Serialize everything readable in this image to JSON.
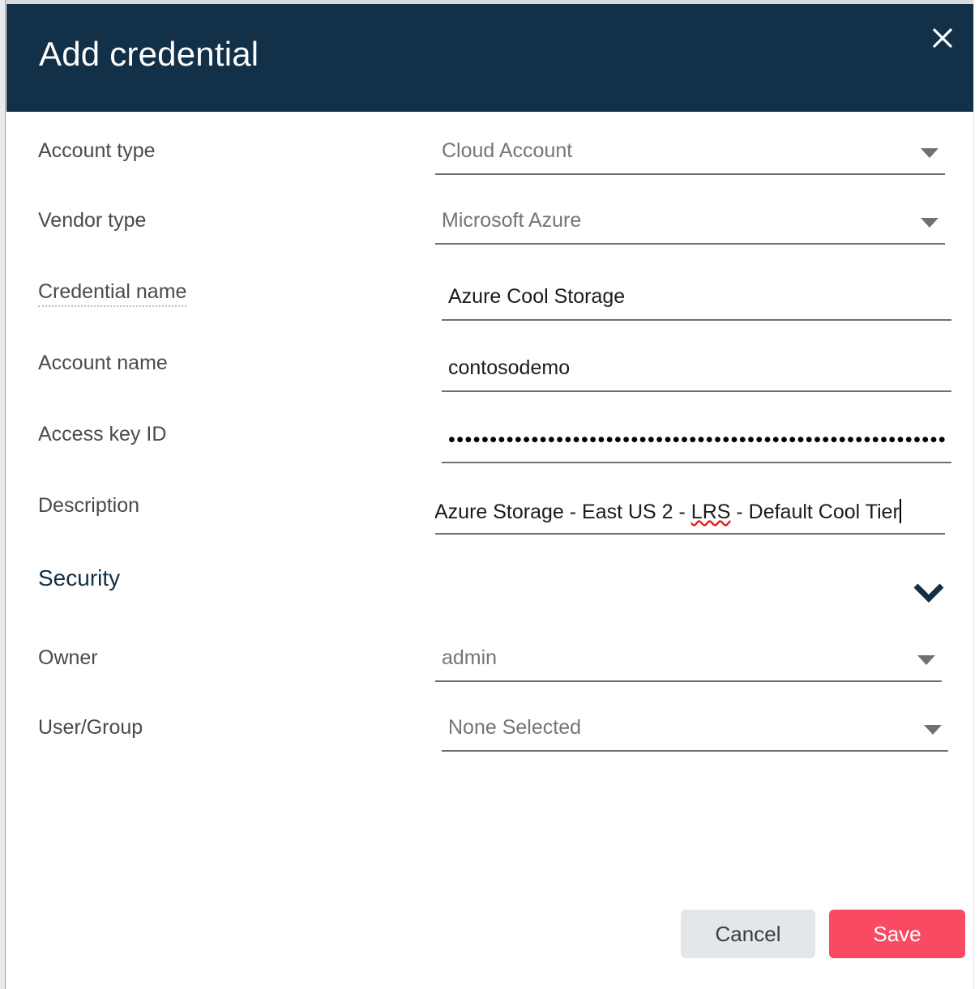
{
  "dialog": {
    "title": "Add credential",
    "close_icon": "close-icon",
    "header_color": "#123048"
  },
  "form": {
    "fields": [
      {
        "label": "Account type",
        "type": "select",
        "value": "Cloud Account",
        "icon": "chevron-down-icon"
      },
      {
        "label": "Vendor type",
        "type": "select",
        "value": "Microsoft Azure",
        "icon": "chevron-down-icon"
      },
      {
        "label": "Credential name",
        "type": "text",
        "value": "Azure Cool Storage",
        "has_tooltip": true
      },
      {
        "label": "Account name",
        "type": "text",
        "value": "contosodemo"
      },
      {
        "label": "Access key ID",
        "type": "password",
        "value": "••••••••••••••••••••••••••••••••••••••••••••••••••••••••••••"
      },
      {
        "label": "Description",
        "type": "text",
        "value_prefix": "Azure Storage - East US 2 - ",
        "value_misspelled": "LRS",
        "value_suffix": " - Default Cool Tier",
        "has_caret": true,
        "has_spellcheck_underline": true
      }
    ]
  },
  "security": {
    "heading": "Security",
    "collapse_icon": "chevron-down-icon",
    "fields": [
      {
        "label": "Owner",
        "type": "select",
        "value": "admin",
        "icon": "chevron-down-icon"
      },
      {
        "label": "User/Group",
        "type": "select",
        "value": "None Selected",
        "icon": "chevron-down-icon"
      }
    ]
  },
  "footer": {
    "cancel_label": "Cancel",
    "save_label": "Save",
    "save_color": "#fa4a63",
    "cancel_color": "#e4e7ea"
  }
}
